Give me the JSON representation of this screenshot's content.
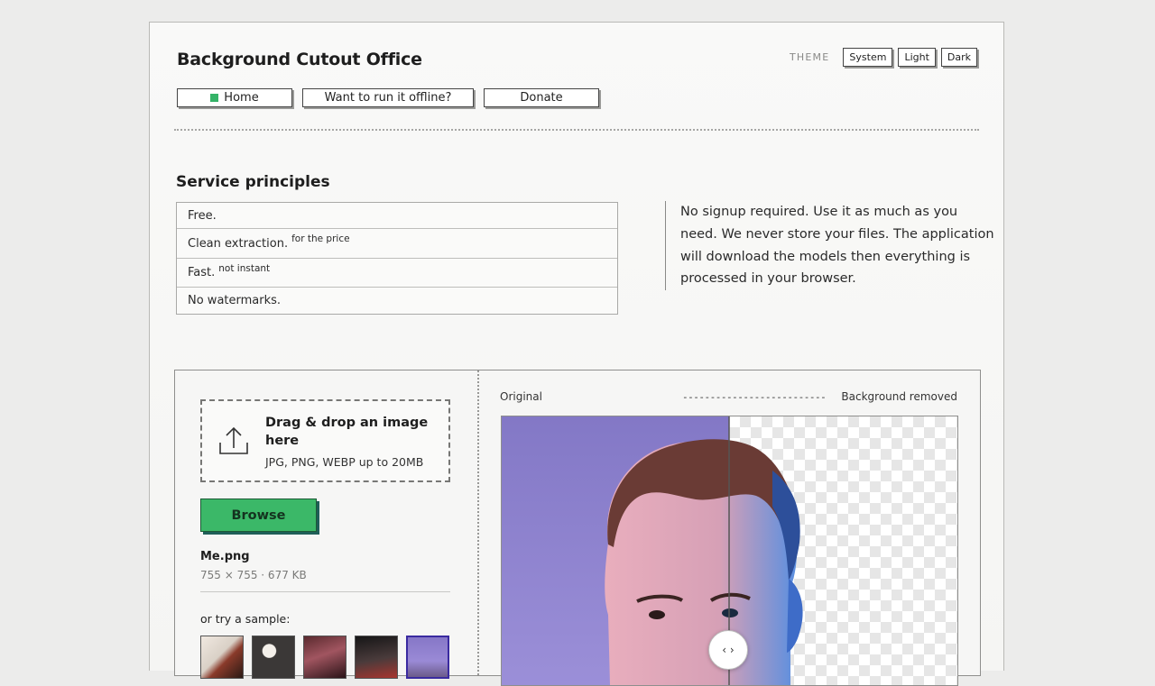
{
  "app": {
    "title": "Background Cutout Office"
  },
  "theme": {
    "label": "THEME",
    "options": [
      "System",
      "Light",
      "Dark"
    ]
  },
  "nav": {
    "home": "Home",
    "offline": "Want to run it offline?",
    "donate": "Donate"
  },
  "principles": {
    "title": "Service principles",
    "items": [
      {
        "text": "Free.",
        "note": ""
      },
      {
        "text": "Clean extraction.",
        "note": "for the price"
      },
      {
        "text": "Fast.",
        "note": "not instant"
      },
      {
        "text": "No watermarks.",
        "note": ""
      }
    ],
    "info": "No signup required. Use it as much as you need. We never store your files. The application will download the models then everything is processed in your browser."
  },
  "upload": {
    "title": "Drag & drop an image here",
    "hint": "JPG, PNG, WEBP up to 20MB",
    "browse": "Browse"
  },
  "file": {
    "name": "Me.png",
    "meta": "755 × 755 · 677 KB"
  },
  "samples": {
    "label": "or try a sample:",
    "items": [
      "sample-1",
      "sample-2",
      "sample-3",
      "sample-4",
      "sample-5"
    ]
  },
  "compare": {
    "original_label": "Original",
    "divider_text": "--------------------------",
    "removed_label": "Background removed",
    "handle_glyph": "‹ ›"
  },
  "colors": {
    "accent": "#3bb868",
    "home_indicator": "#35b368",
    "original_bg": "#8b80cc"
  }
}
